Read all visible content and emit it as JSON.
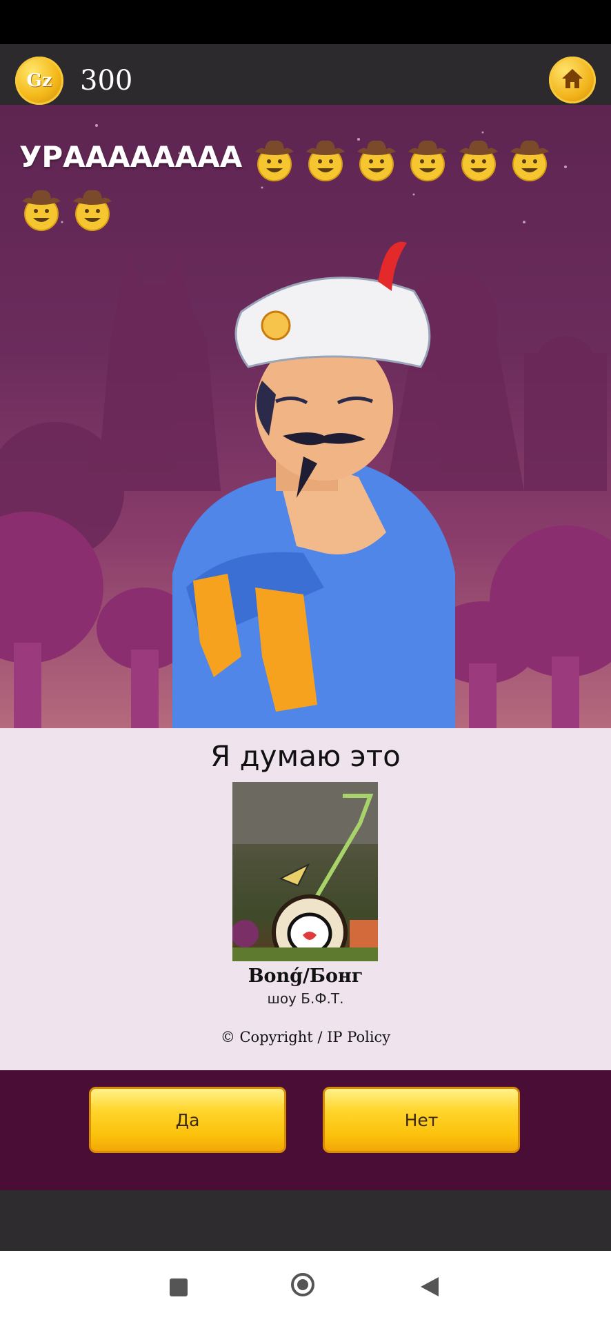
{
  "header": {
    "coin_logo": "Gz",
    "coin_count": "300",
    "home_icon": "home-icon"
  },
  "scene": {
    "message": "УРАААААААА",
    "emoji": "cowboy-face-emoji",
    "emoji_count": 8,
    "character": "genie-character"
  },
  "guess": {
    "title": "Я думаю это",
    "name": "Bonǵ/Бонг",
    "subtitle": "шоу Б.Ф.Т.",
    "copyright": "© Copyright / IP Policy"
  },
  "answers": {
    "yes_label": "Да",
    "no_label": "Нет"
  },
  "nav": {
    "recents": "recents-icon",
    "home": "home-circle-icon",
    "back": "back-icon"
  },
  "colors": {
    "panel": "#efe4ee",
    "answer_bar": "#4a0d35",
    "button": "#ffd52c",
    "scene_top": "#5e2551"
  }
}
